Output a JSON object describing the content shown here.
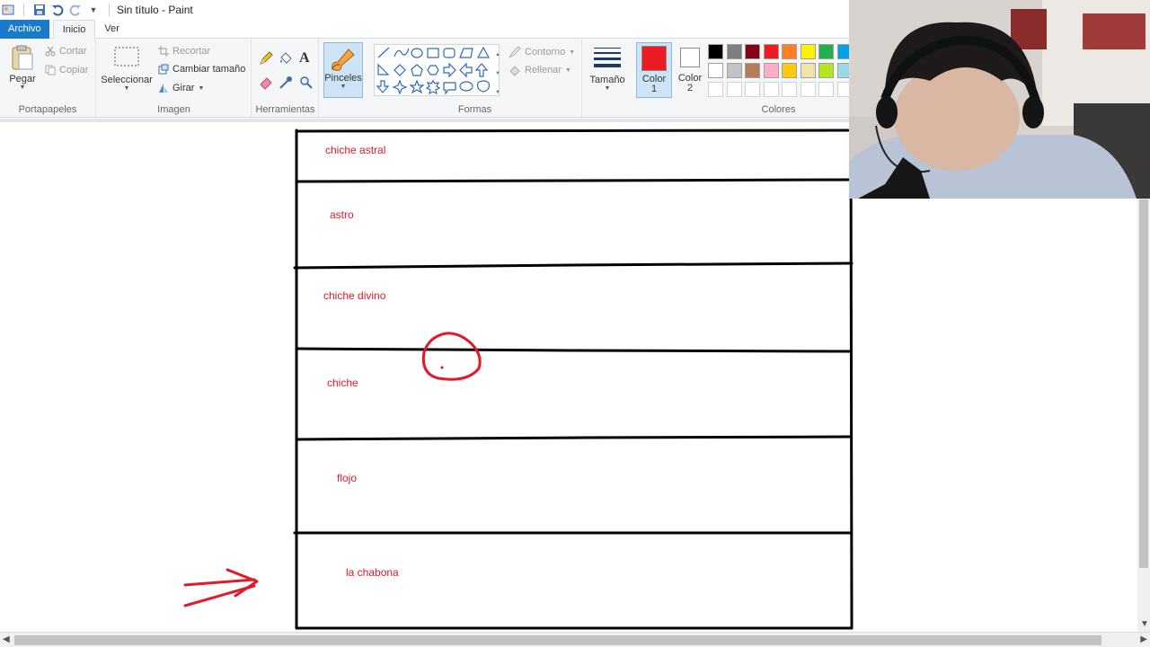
{
  "window": {
    "title": "Sin título - Paint"
  },
  "tabs": {
    "file": "Archivo",
    "home": "Inicio",
    "view": "Ver"
  },
  "clipboard": {
    "paste": "Pegar",
    "cut": "Cortar",
    "copy": "Copiar",
    "label": "Portapapeles"
  },
  "image": {
    "select": "Seleccionar",
    "crop": "Recortar",
    "resize": "Cambiar tamaño",
    "rotate": "Girar",
    "label": "Imagen"
  },
  "tools": {
    "label": "Herramientas",
    "brushes": "Pinceles"
  },
  "shapes": {
    "outline": "Contorno",
    "fill": "Rellenar",
    "label": "Formas"
  },
  "size": {
    "label": "Tamaño"
  },
  "colors": {
    "color1_line1": "Color",
    "color1_line2": "1",
    "color2_line1": "Color",
    "color2_line2": "2",
    "label": "Colores",
    "color1": "#ed1c24",
    "color2": "#ffffff",
    "palette_row1": [
      "#000000",
      "#7f7f7f",
      "#880015",
      "#ed1c24",
      "#ff7f27",
      "#fff200",
      "#22b14c",
      "#00a2e8"
    ],
    "palette_row2": [
      "#ffffff",
      "#c3c3c3",
      "#b97a57",
      "#ffaec9",
      "#ffc90e",
      "#efe4b0",
      "#b5e61d",
      "#99d9ea"
    ]
  },
  "canvas": {
    "rows": [
      "chiche astral",
      "astro",
      "chiche divino",
      "chiche",
      "flojo",
      "la chabona"
    ],
    "ink_color": "#e0192b"
  },
  "icons": [
    "save-icon",
    "undo-icon",
    "redo-icon",
    "paste-icon",
    "scissors-icon",
    "copy-icon",
    "select-icon",
    "crop-icon",
    "resize-icon",
    "rotate-icon",
    "pencil-icon",
    "fill-bucket-icon",
    "text-icon",
    "eraser-icon",
    "color-picker-icon",
    "magnifier-icon",
    "brush-icon",
    "size-lines-icon"
  ]
}
